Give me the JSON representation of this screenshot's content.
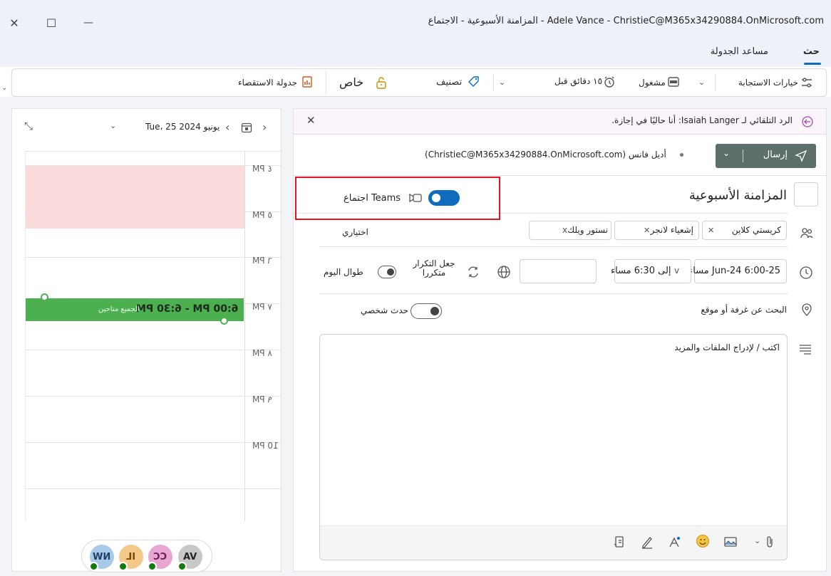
{
  "window": {
    "title": "Adele Vance - ChristieC@M365x34290884.OnMicrosoft.com - المزامنة الأسبوعية - الاجتماع",
    "close_label": "✕",
    "maximize_label": "☐",
    "minimize_label": "—"
  },
  "tabs": [
    {
      "label": "حث"
    },
    {
      "label": "مساعد الجدولة"
    }
  ],
  "ribbon": {
    "response_options": "خيارات الاستجابة",
    "busy": "مشغول",
    "reminder": "١٥ دقائق قبل",
    "categorize": "تصنيف",
    "private": "خاص",
    "poll": "جدولة الاستقصاء"
  },
  "calendar": {
    "date_label": "Tue، 25 يونيو 2024",
    "hours": [
      "٤ PM",
      "٥ PM",
      "٦ PM",
      "٧ PM",
      "٨ PM",
      "٩ PM",
      "10 PM"
    ],
    "event_time": "6:00 PM - 6:30 PM",
    "event_sub": "الجميع متاحين",
    "attendees": [
      {
        "initials": "VA",
        "color": "#c8c8c8"
      },
      {
        "initials": "CC",
        "color": "#e8a6d2"
      },
      {
        "initials": "IL",
        "color": "#f3c98b"
      },
      {
        "initials": "NW",
        "color": "#a9c9e8"
      }
    ]
  },
  "form": {
    "auto_reply": "الرد التلقائي لـ Isaiah Langer: أنا حاليًا في إجازة.",
    "send_label": "إرسال",
    "from": "أديل فانس (ChristieC@M365x34290884.OnMicrosoft.com)",
    "title": "المزامنة الأسبوعية",
    "teams_label": "اجتماع Teams",
    "attendees": [
      {
        "name": "كريستي كلاين"
      },
      {
        "name": "إشعياء لانجر"
      },
      {
        "name": "نستور ويلك"
      }
    ],
    "optional_label": "اختياري",
    "start": "25-Jun-24 6:00 مساء",
    "end": "إلى 6:30 مساء",
    "recurring": "جعل التكرار متكررا",
    "all_day": "طوال اليوم",
    "location": "البحث عن غرفة أو موقع",
    "private_event": "حدث شخصي",
    "body_placeholder": "اكتب / لإدراج الملفات والمزيد"
  },
  "colors": {
    "accent": "#0f6cbd",
    "event_green": "#4caf50",
    "busy_pink": "#fadbdb",
    "highlight_red": "#e81123",
    "send_bg": "#5c6f6b"
  }
}
